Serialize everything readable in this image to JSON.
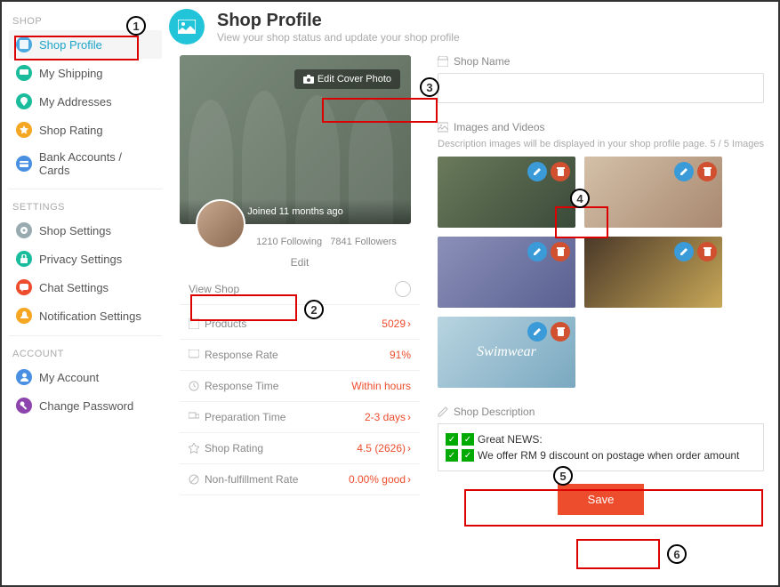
{
  "sidebar": {
    "sections": [
      {
        "title": "SHOP",
        "items": [
          {
            "label": "Shop Profile",
            "icon": "photo-icon",
            "color": "#4aa8e0",
            "active": true
          },
          {
            "label": "My Shipping",
            "icon": "truck-icon",
            "color": "#1abc9c"
          },
          {
            "label": "My Addresses",
            "icon": "pin-icon",
            "color": "#1abc9c"
          },
          {
            "label": "Shop Rating",
            "icon": "star-icon",
            "color": "#f5a623"
          },
          {
            "label": "Bank Accounts / Cards",
            "icon": "card-icon",
            "color": "#4a90e2"
          }
        ]
      },
      {
        "title": "SETTINGS",
        "items": [
          {
            "label": "Shop Settings",
            "icon": "gear-icon",
            "color": "#9aa"
          },
          {
            "label": "Privacy Settings",
            "icon": "lock-icon",
            "color": "#1abc9c"
          },
          {
            "label": "Chat Settings",
            "icon": "chat-icon",
            "color": "#ee4d2d"
          },
          {
            "label": "Notification Settings",
            "icon": "bell-icon",
            "color": "#f5a623"
          }
        ]
      },
      {
        "title": "ACCOUNT",
        "items": [
          {
            "label": "My Account",
            "icon": "user-icon",
            "color": "#4a90e2"
          },
          {
            "label": "Change Password",
            "icon": "key-icon",
            "color": "#8e44ad"
          }
        ]
      }
    ]
  },
  "header": {
    "title": "Shop Profile",
    "subtitle": "View your shop status and update your shop profile"
  },
  "cover": {
    "edit_label": "Edit Cover Photo",
    "joined": "Joined 11 months ago",
    "following_count": "1210",
    "following_label": "Following",
    "followers_count": "7841",
    "followers_label": "Followers",
    "edit_btn": "Edit",
    "view_shop": "View Shop"
  },
  "stats": [
    {
      "icon": "box-icon",
      "label": "Products",
      "value": "5029",
      "chevron": true
    },
    {
      "icon": "chat-icon",
      "label": "Response Rate",
      "value": "91%"
    },
    {
      "icon": "clock-icon",
      "label": "Response Time",
      "value": "Within hours"
    },
    {
      "icon": "truck-icon",
      "label": "Preparation Time",
      "value": "2-3 days",
      "chevron": true
    },
    {
      "icon": "star-icon",
      "label": "Shop Rating",
      "value": "4.5 (2626)",
      "chevron": true
    },
    {
      "icon": "ban-icon",
      "label": "Non-fulfillment Rate",
      "value": "0.00% good",
      "chevron": true
    }
  ],
  "form": {
    "shop_name_label": "Shop Name",
    "shop_name_value": "",
    "images_label": "Images and Videos",
    "images_hint": "Description images will be displayed in your shop profile page.",
    "images_count": "5 / 5 Images",
    "thumb5_text": "Swimwear",
    "desc_label": "Shop Description",
    "desc_line1": "Great NEWS:",
    "desc_line2": "We offer RM 9 discount on postage when order amount",
    "save_label": "Save"
  },
  "annotations": {
    "n1": "1",
    "n2": "2",
    "n3": "3",
    "n4": "4",
    "n5": "5",
    "n6": "6"
  }
}
